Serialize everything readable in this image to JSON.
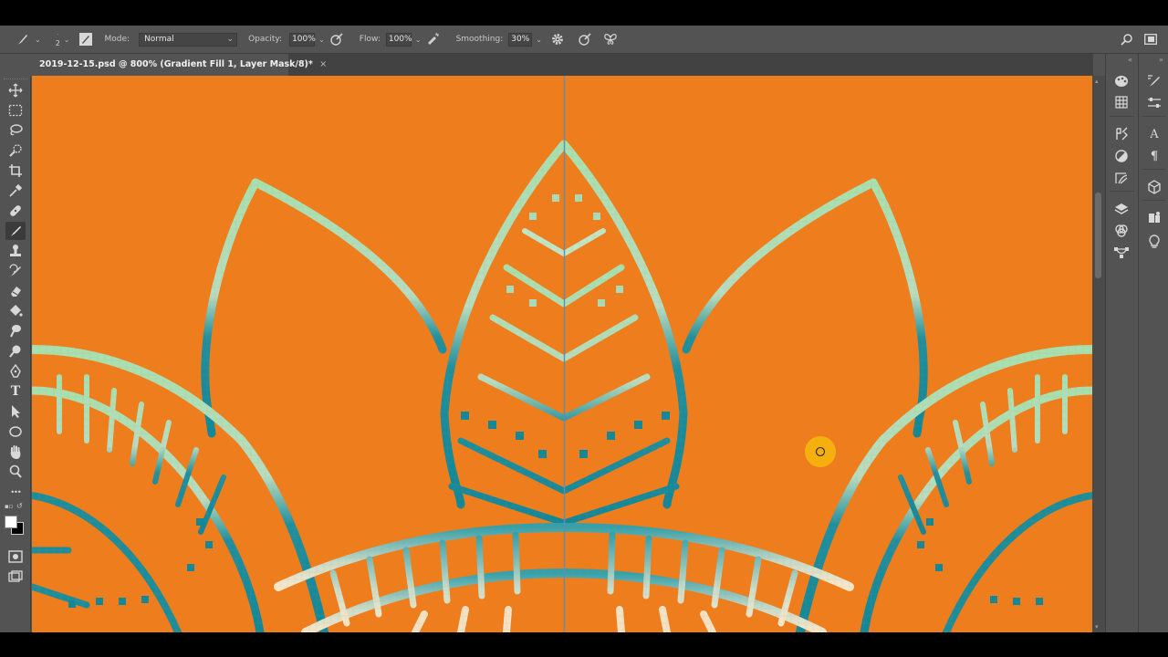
{
  "options_bar": {
    "brush_size": "2",
    "mode_label": "Mode:",
    "mode_value": "Normal",
    "opacity_label": "Opacity:",
    "opacity_value": "100%",
    "flow_label": "Flow:",
    "flow_value": "100%",
    "smoothing_label": "Smoothing:",
    "smoothing_value": "30%"
  },
  "document_tab": {
    "title": "2019-12-15.psd @ 800% (Gradient Fill 1, Layer Mask/8)",
    "modified_marker": "*",
    "close_glyph": "×"
  },
  "tools": [
    {
      "name": "move-tool",
      "icon": "move-icon"
    },
    {
      "name": "marquee-tool",
      "icon": "marquee-icon"
    },
    {
      "name": "lasso-tool",
      "icon": "lasso-icon"
    },
    {
      "name": "quick-selection-tool",
      "icon": "quick-select-icon"
    },
    {
      "name": "crop-tool",
      "icon": "crop-icon"
    },
    {
      "name": "eyedropper-tool",
      "icon": "eyedropper-icon"
    },
    {
      "name": "healing-brush-tool",
      "icon": "bandage-icon"
    },
    {
      "name": "brush-tool",
      "icon": "brush-icon",
      "active": true
    },
    {
      "name": "clone-stamp-tool",
      "icon": "stamp-icon"
    },
    {
      "name": "history-brush-tool",
      "icon": "history-brush-icon"
    },
    {
      "name": "eraser-tool",
      "icon": "eraser-icon"
    },
    {
      "name": "paint-bucket-tool",
      "icon": "bucket-icon"
    },
    {
      "name": "smudge-tool",
      "icon": "smudge-icon"
    },
    {
      "name": "dodge-tool",
      "icon": "dodge-icon"
    },
    {
      "name": "pen-tool",
      "icon": "pen-icon"
    },
    {
      "name": "type-tool",
      "icon": "type-icon",
      "text": "T"
    },
    {
      "name": "path-selection-tool",
      "icon": "arrow-icon"
    },
    {
      "name": "ellipse-tool",
      "icon": "ellipse-icon"
    },
    {
      "name": "hand-tool",
      "icon": "hand-icon"
    },
    {
      "name": "zoom-tool",
      "icon": "zoom-icon"
    },
    {
      "name": "more-tools",
      "icon": "ellipsis-icon",
      "text": "•••"
    }
  ],
  "colors": {
    "ui_bg": "#535353",
    "canvas_orange": "#ee7d1d",
    "pattern_teal": "#138a98",
    "pattern_mint": "#98d6b0",
    "pattern_cream": "#f2e2c4",
    "foreground_swatch": "#ffffff",
    "background_swatch": "#000000",
    "cursor_yellow": "#f5b010"
  },
  "right_dock_1": [
    "color-palette-icon",
    "swatches-grid-icon",
    "brush-settings-icon",
    "adjustments-icon",
    "styles-icon",
    "layers-icon",
    "channels-icon",
    "paths-icon"
  ],
  "right_dock_2": [
    "brushes-icon",
    "properties-sliders-icon",
    "character-icon",
    "paragraph-icon",
    "3d-cube-icon",
    "libraries-icon",
    "learn-lightbulb-icon"
  ]
}
